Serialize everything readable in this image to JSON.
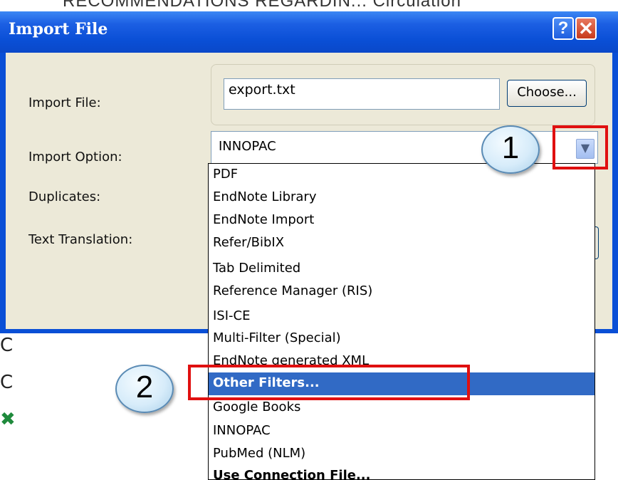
{
  "background": {
    "top_text": "RECOMMENDATIONS REGARDIN...     Circulation"
  },
  "dialog": {
    "title": "Import File",
    "help_glyph": "?",
    "close_glyph": "✕",
    "labels": {
      "import_file": "Import File:",
      "import_option": "Import Option:",
      "duplicates": "Duplicates:",
      "text_translation": "Text Translation:"
    },
    "file_input_value": "export.txt",
    "choose_label": "Choose...",
    "import_option_value": "INNOPAC"
  },
  "dropdown": {
    "options": [
      "PDF",
      "EndNote Library",
      "EndNote Import",
      "Refer/BibIX",
      "Tab Delimited",
      "Reference Manager (RIS)",
      "ISI-CE",
      "Multi-Filter (Special)",
      "EndNote generated XML",
      "Other Filters...",
      "Google Books",
      "INNOPAC",
      "PubMed (NLM)",
      "Use Connection File..."
    ],
    "selected": "Other Filters..."
  },
  "callouts": {
    "step1": "1",
    "step2": "2"
  },
  "colors": {
    "titlebar": "#0a4fd6",
    "dialog_bg": "#ece9d8",
    "selection": "#316ac5",
    "highlight_box": "#e01010"
  }
}
